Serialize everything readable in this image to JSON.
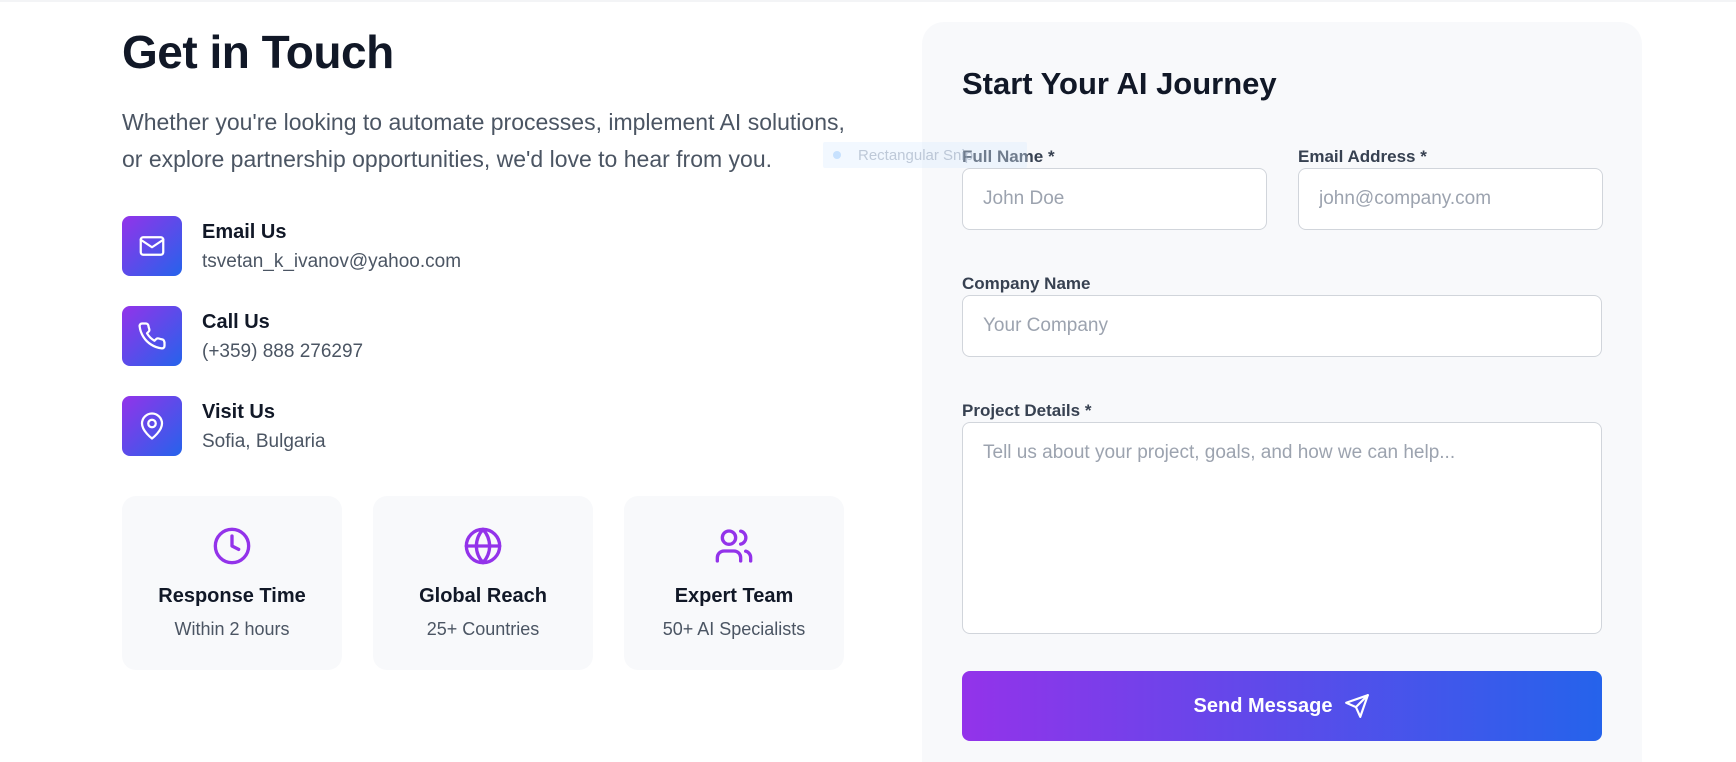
{
  "left": {
    "title": "Get in Touch",
    "intro": "Whether you're looking to automate processes, implement AI solutions, or explore partnership opportunities, we'd love to hear from you.",
    "contacts": [
      {
        "label": "Email Us",
        "value": "tsvetan_k_ivanov@yahoo.com",
        "icon": "mail-icon"
      },
      {
        "label": "Call Us",
        "value": "(+359) 888 276297",
        "icon": "phone-icon"
      },
      {
        "label": "Visit Us",
        "value": "Sofia, Bulgaria",
        "icon": "map-pin-icon"
      }
    ],
    "features": [
      {
        "title": "Response Time",
        "subtitle": "Within 2 hours",
        "icon": "clock-icon"
      },
      {
        "title": "Global Reach",
        "subtitle": "25+ Countries",
        "icon": "globe-icon"
      },
      {
        "title": "Expert Team",
        "subtitle": "50+ AI Specialists",
        "icon": "users-icon"
      }
    ]
  },
  "overlay": {
    "text": "Rectangular Snip"
  },
  "form": {
    "title": "Start Your AI Journey",
    "full_name": {
      "label": "Full Name *",
      "placeholder": "John Doe"
    },
    "email": {
      "label": "Email Address *",
      "placeholder": "john@company.com"
    },
    "company": {
      "label": "Company Name",
      "placeholder": "Your Company"
    },
    "details": {
      "label": "Project Details *",
      "placeholder": "Tell us about your project, goals, and how we can help..."
    },
    "submit_label": "Send Message"
  },
  "colors": {
    "accent_purple": "#9333ea",
    "accent_blue": "#2563eb",
    "card_bg": "#f8f9fb",
    "text_dark": "#111827",
    "text_muted": "#4b5563"
  }
}
